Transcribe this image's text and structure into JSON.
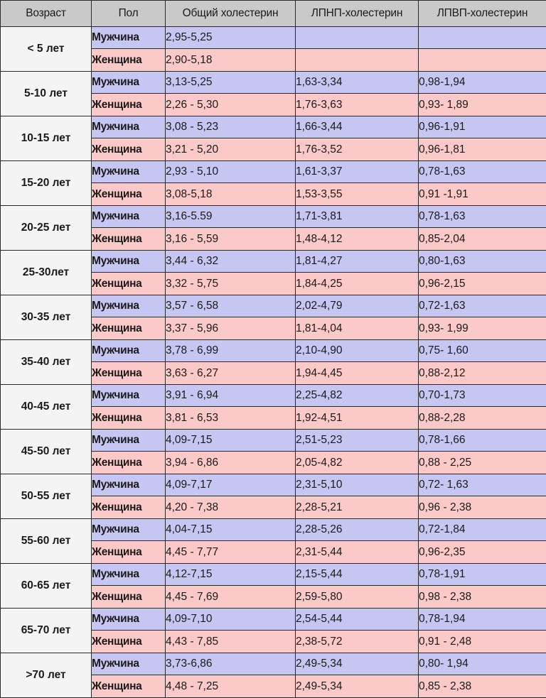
{
  "table": {
    "headers": [
      "Возраст",
      "Пол",
      "Общий холестерин",
      "ЛПНП-холестерин",
      "ЛПВП-холестерин"
    ],
    "gender_labels": {
      "male": "Мужчина",
      "female": "Женщина"
    },
    "colors": {
      "header_bg": "#c9c9c9",
      "age_bg": "#f4f4f4",
      "male_bg": "#c6c6f2",
      "female_bg": "#fbc9c7",
      "border": "#1a1a1a",
      "text": "#1a1a1a"
    },
    "groups": [
      {
        "age": "< 5 лет",
        "male": {
          "sex": "Мужчина",
          "total": "2,95-5,25",
          "ldl": "",
          "hdl": ""
        },
        "female": {
          "sex": "Женщина",
          "total": "2,90-5,18",
          "ldl": "",
          "hdl": ""
        }
      },
      {
        "age": "5-10 лет",
        "male": {
          "sex": "Мужчина",
          "total": "3,13-5,25",
          "ldl": "1,63-3,34",
          "hdl": "0,98-1,94"
        },
        "female": {
          "sex": "Женщина",
          "total": "2,26 - 5,30",
          "ldl": "1,76-3,63",
          "hdl": "0,93- 1,89"
        }
      },
      {
        "age": "10-15 лет",
        "male": {
          "sex": "Мужчина",
          "total": "3,08 - 5,23",
          "ldl": "1,66-3,44",
          "hdl": "0,96-1,91"
        },
        "female": {
          "sex": "Женщина",
          "total": "3,21 - 5,20",
          "ldl": "1,76-3,52",
          "hdl": "0,96-1,81"
        }
      },
      {
        "age": "15-20 лет",
        "male": {
          "sex": "Мужчина",
          "total": "2,93 - 5,10",
          "ldl": "1,61-3,37",
          "hdl": "0,78-1,63"
        },
        "female": {
          "sex": "Женщина",
          "total": "3,08-5,18",
          "ldl": "1,53-3,55",
          "hdl": "0,91 -1,91"
        }
      },
      {
        "age": "20-25 лет",
        "male": {
          "sex": "Мужчина",
          "total": "3,16-5.59",
          "ldl": "1,71-3,81",
          "hdl": "0,78-1,63"
        },
        "female": {
          "sex": "Женщина",
          "total": "3,16 - 5,59",
          "ldl": "1,48-4,12",
          "hdl": "0,85-2,04"
        }
      },
      {
        "age": "25-30лет",
        "male": {
          "sex": "Мужчина",
          "total": "3,44 - 6,32",
          "ldl": "1,81-4,27",
          "hdl": "0,80-1,63"
        },
        "female": {
          "sex": "Женщина",
          "total": "3,32 - 5,75",
          "ldl": "1,84-4,25",
          "hdl": "0,96-2,15"
        }
      },
      {
        "age": "30-35 лет",
        "male": {
          "sex": "Мужчина",
          "total": "3,57 - 6,58",
          "ldl": "2,02-4,79",
          "hdl": "0,72-1,63"
        },
        "female": {
          "sex": "Женщина",
          "total": "3,37 - 5,96",
          "ldl": "1,81-4,04",
          "hdl": "0,93- 1,99"
        }
      },
      {
        "age": "35-40 лет",
        "male": {
          "sex": "Мужчина",
          "total": "3,78 - 6,99",
          "ldl": "2,10-4,90",
          "hdl": "0,75- 1,60"
        },
        "female": {
          "sex": "Женщина",
          "total": "3,63 - 6,27",
          "ldl": "1,94-4,45",
          "hdl": "0,88-2,12"
        }
      },
      {
        "age": "40-45 лет",
        "male": {
          "sex": "Мужчина",
          "total": "3,91 - 6,94",
          "ldl": "2,25-4,82",
          "hdl": "0,70-1,73"
        },
        "female": {
          "sex": "Женщина",
          "total": "3,81 - 6,53",
          "ldl": "1,92-4,51",
          "hdl": "0,88-2,28"
        }
      },
      {
        "age": "45-50 лет",
        "male": {
          "sex": "Мужчина",
          "total": "4,09-7,15",
          "ldl": "2,51-5,23",
          "hdl": "0,78-1,66"
        },
        "female": {
          "sex": "Женщина",
          "total": "3,94 - 6,86",
          "ldl": "2,05-4,82",
          "hdl": "0,88 - 2,25"
        }
      },
      {
        "age": "50-55 лет",
        "male": {
          "sex": "Мужчина",
          "total": "4,09-7,17",
          "ldl": "2,31-5,10",
          "hdl": "0,72- 1,63"
        },
        "female": {
          "sex": "Женщина",
          "total": "4,20 - 7,38",
          "ldl": "2,28-5,21",
          "hdl": "0,96 - 2,38"
        }
      },
      {
        "age": "55-60 лет",
        "male": {
          "sex": "Мужчина",
          "total": "4,04-7,15",
          "ldl": "2,28-5,26",
          "hdl": "0,72-1,84"
        },
        "female": {
          "sex": "Женщина",
          "total": "4,45 - 7,77",
          "ldl": "2,31-5,44",
          "hdl": "0,96-2,35"
        }
      },
      {
        "age": "60-65 лет",
        "male": {
          "sex": "Мужчина",
          "total": "4,12-7,15",
          "ldl": "2,15-5,44",
          "hdl": "0,78-1,91"
        },
        "female": {
          "sex": "Женщина",
          "total": "4,45 - 7,69",
          "ldl": "2,59-5,80",
          "hdl": "0,98 - 2,38"
        }
      },
      {
        "age": "65-70 лет",
        "male": {
          "sex": "Мужчина",
          "total": "4,09-7,10",
          "ldl": "2,54-5,44",
          "hdl": "0,78-1,94"
        },
        "female": {
          "sex": "Женщина",
          "total": "4,43 - 7,85",
          "ldl": "2,38-5,72",
          "hdl": "0,91 - 2,48"
        }
      },
      {
        "age": ">70 лет",
        "male": {
          "sex": "Мужчина",
          "total": "3,73-6,86",
          "ldl": "2,49-5,34",
          "hdl": "0,80- 1,94"
        },
        "female": {
          "sex": "Женщина",
          "total": "4,48 - 7,25",
          "ldl": "2,49-5,34",
          "hdl": "0,85 - 2,38"
        }
      }
    ]
  }
}
